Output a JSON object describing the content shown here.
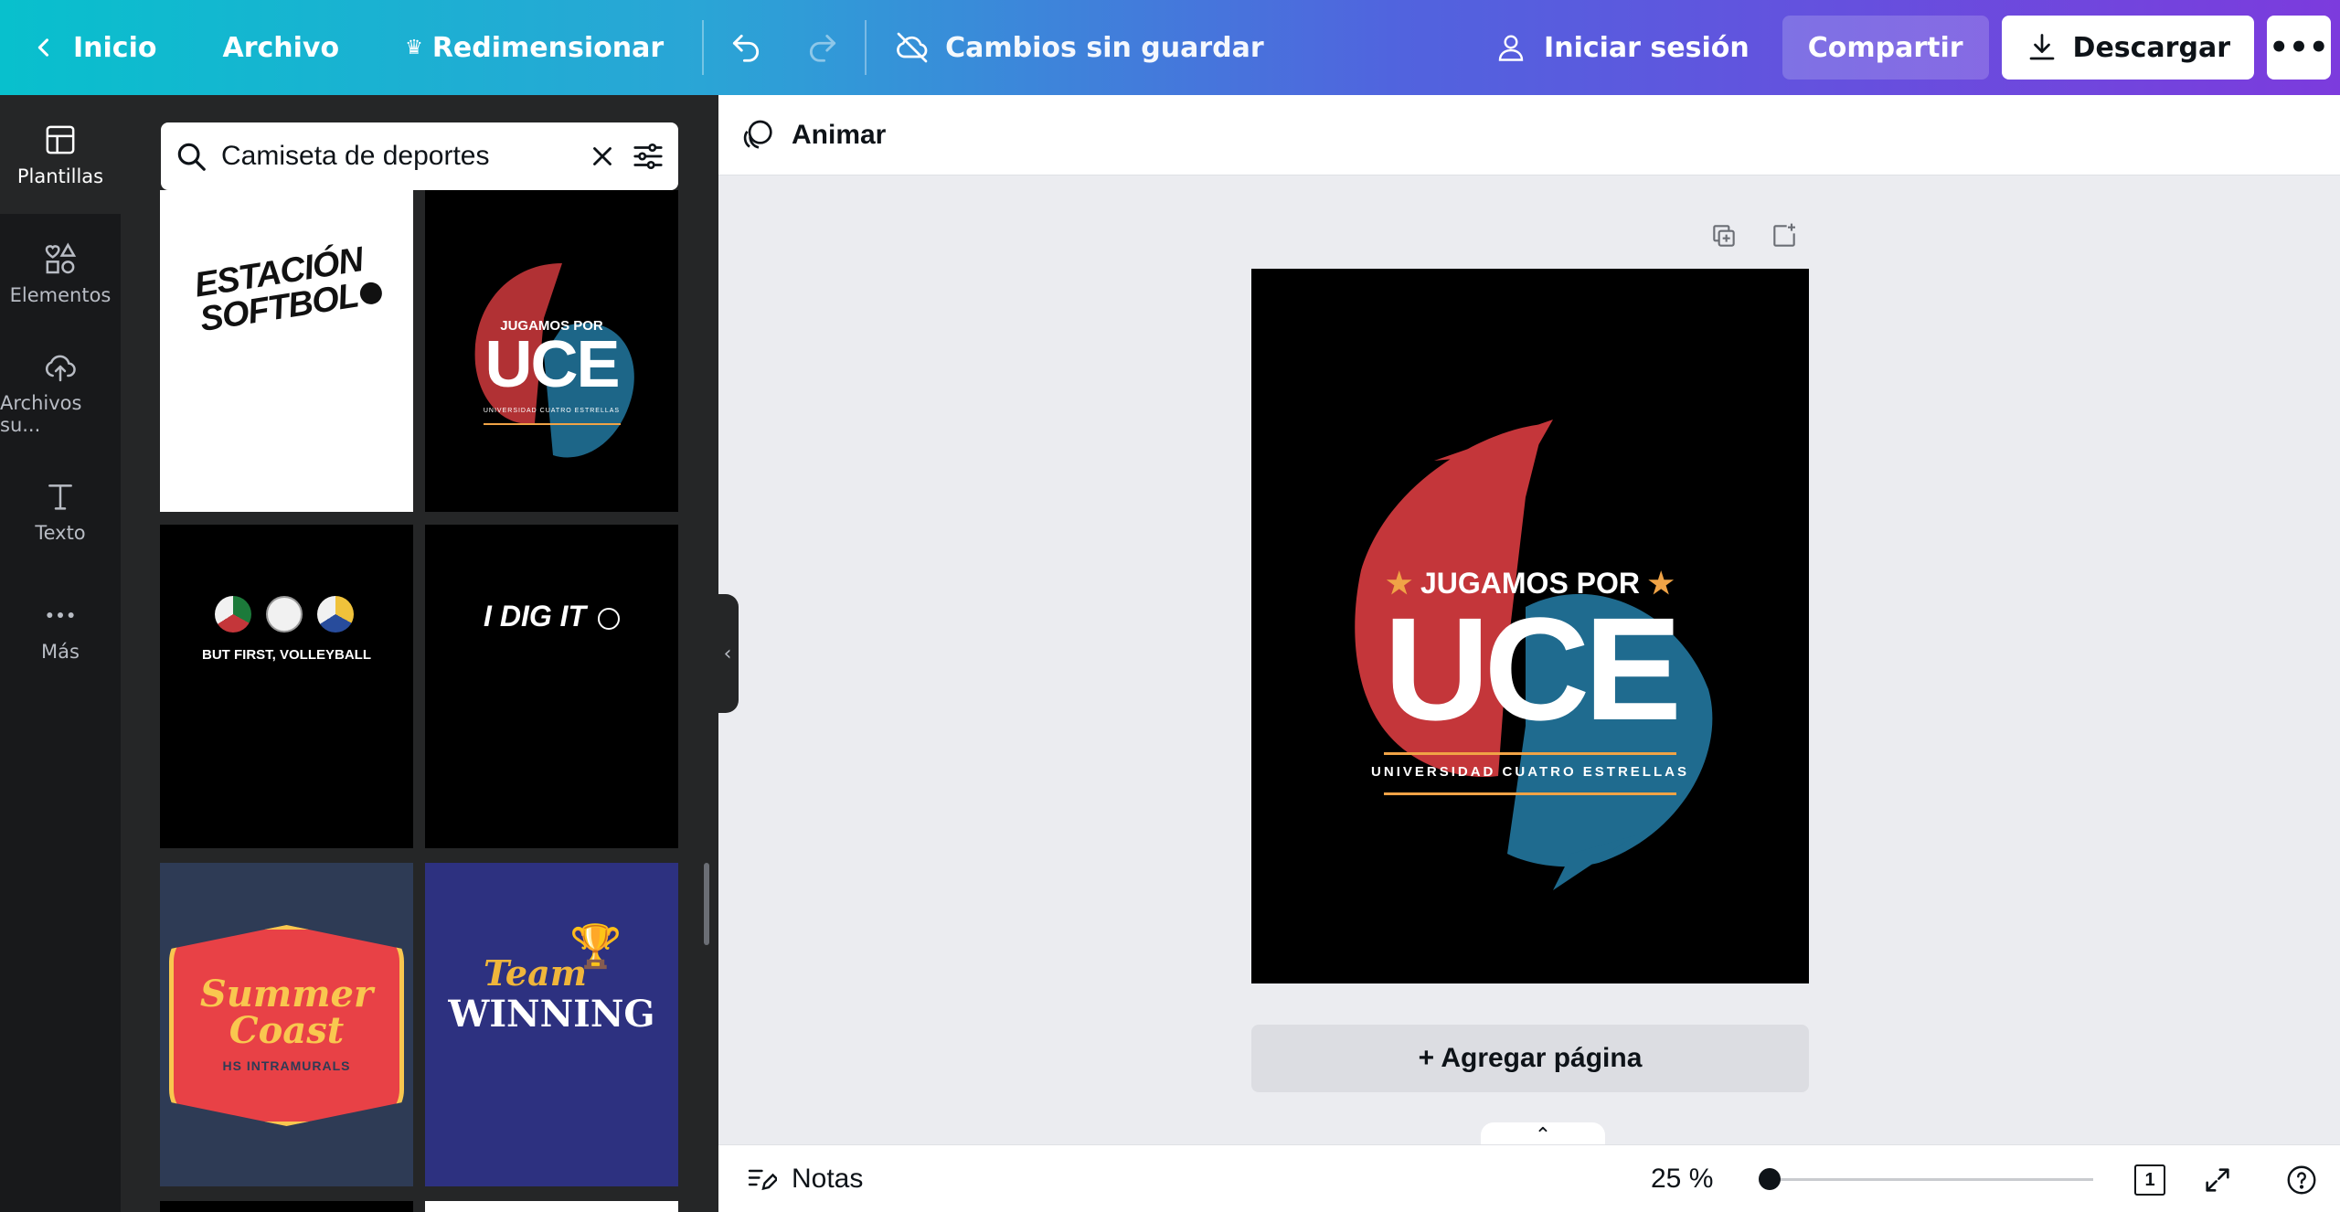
{
  "topbar": {
    "home_label": "Inicio",
    "file_label": "Archivo",
    "resize_label": "Redimensionar",
    "status_label": "Cambios sin guardar",
    "signin_label": "Iniciar sesión",
    "share_label": "Compartir",
    "download_label": "Descargar"
  },
  "rail": {
    "items": [
      {
        "label": "Plantillas",
        "icon": "templates-icon"
      },
      {
        "label": "Elementos",
        "icon": "elements-icon"
      },
      {
        "label": "Archivos su...",
        "icon": "upload-cloud-icon"
      },
      {
        "label": "Texto",
        "icon": "text-icon"
      },
      {
        "label": "Más",
        "icon": "more-icon"
      }
    ]
  },
  "search": {
    "value": "Camiseta de deportes"
  },
  "templates": {
    "estacion": {
      "line1": "ESTACIÓN",
      "line2": "SOFTBOL"
    },
    "uce_small": {
      "top": "JUGAMOS POR",
      "main": "UCE",
      "sub": "UNIVERSIDAD CUATRO ESTRELLAS"
    },
    "volleyball": {
      "text": "BUT FIRST, VOLLEYBALL"
    },
    "idigit": {
      "text": "I DIG IT"
    },
    "summer": {
      "line1": "Summer",
      "line2": "Coast",
      "sub": "HS INTRAMURALS"
    },
    "team": {
      "line1": "Team",
      "line2": "WINNING"
    }
  },
  "toolbar": {
    "animate_label": "Animar"
  },
  "design": {
    "top": "JUGAMOS POR",
    "main": "UCE",
    "sub": "UNIVERSIDAD CUATRO ESTRELLAS"
  },
  "canvas": {
    "add_page_label": "+ Agregar página"
  },
  "bottombar": {
    "notes_label": "Notas",
    "zoom_label": "25 %",
    "zoom_value": 25,
    "page_number": "1"
  },
  "colors": {
    "accent_purple": "#7d2ae8",
    "teal": "#08c0cd",
    "uce_red": "#c4363a",
    "uce_blue": "#1f6b8f",
    "uce_orange": "#f0a346",
    "team_bg": "#2d3180",
    "summer_red": "#e84146",
    "summer_yellow": "#f9c74f"
  }
}
